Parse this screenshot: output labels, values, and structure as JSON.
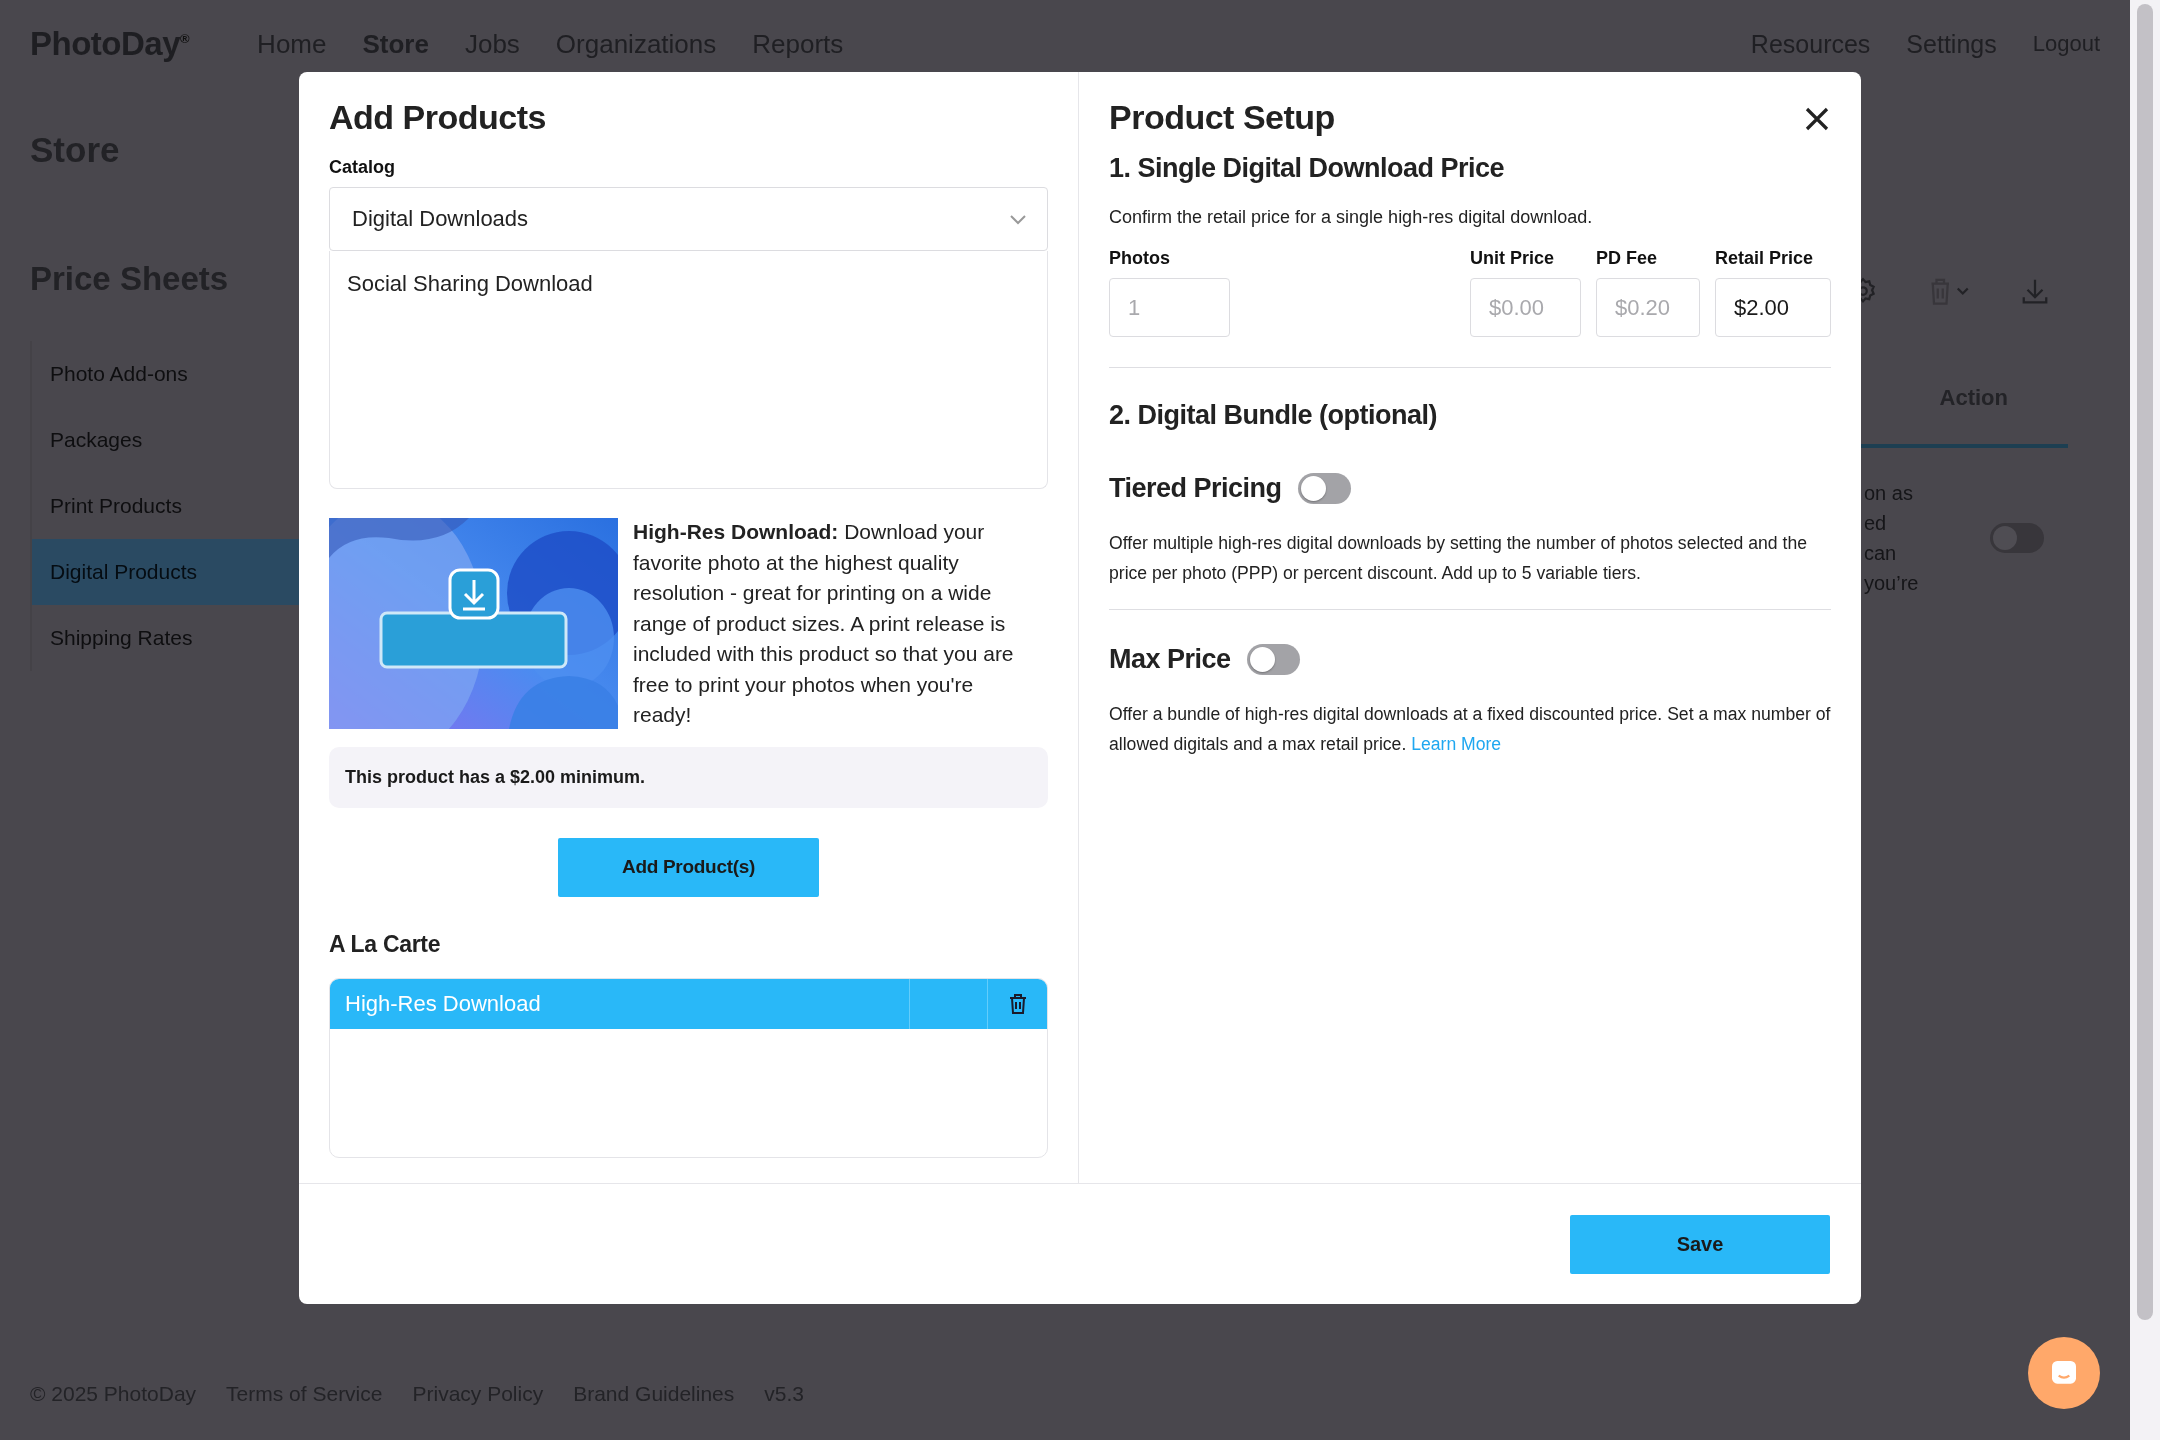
{
  "nav": {
    "logo": "PhotoDay",
    "logo_mark": "®",
    "links": [
      {
        "label": "Home",
        "selected": false
      },
      {
        "label": "Store",
        "selected": true
      },
      {
        "label": "Jobs",
        "selected": false
      },
      {
        "label": "Organizations",
        "selected": false
      },
      {
        "label": "Reports",
        "selected": false
      }
    ],
    "right_links": [
      "Resources",
      "Settings",
      "Logout"
    ]
  },
  "page": {
    "title": "Store",
    "section_title": "Price Sheets",
    "sidebar": [
      {
        "label": "Photo Add-ons",
        "selected": false
      },
      {
        "label": "Packages",
        "selected": false
      },
      {
        "label": "Print Products",
        "selected": false
      },
      {
        "label": "Digital Products",
        "selected": true
      },
      {
        "label": "Shipping Rates",
        "selected": false
      }
    ],
    "table": {
      "header": "Action",
      "cell_fragments": [
        "on as",
        "ed",
        "can",
        "you’re"
      ],
      "toggle": {
        "on": false
      }
    }
  },
  "modal": {
    "add_products": {
      "title": "Add Products",
      "catalog_label": "Catalog",
      "catalog_value": "Digital Downloads",
      "products": [
        "Social Sharing Download"
      ],
      "product": {
        "description": "**High-Res Download:** Download your favorite photo at the highest quality resolution - great for printing on a wide range of product sizes. A print release is included with this product so that you are free to print your photos when you're ready!",
        "notice": "This product has a $2.00 minimum."
      },
      "add_button": "Add Product(s)",
      "a_la_carte": {
        "title": "A La Carte",
        "rows": [
          {
            "name": "High-Res Download",
            "selected": true
          }
        ]
      }
    },
    "product_setup": {
      "title": "Product Setup",
      "section_1": {
        "title": "1. Single Digital Download Price",
        "description": "Confirm the retail price for a single high-res digital download.",
        "fields": [
          {
            "label": "Photos",
            "value": "1",
            "disabled": true
          },
          {
            "label": "Unit Price",
            "value": "$0.00",
            "disabled": true
          },
          {
            "label": "PD Fee",
            "value": "$0.20",
            "disabled": true
          },
          {
            "label": "Retail Price",
            "value": "$2.00",
            "disabled": false
          }
        ]
      },
      "section_2": {
        "title": "2. Digital Bundle (optional)",
        "options": [
          {
            "label": "Tiered Pricing",
            "on": false,
            "description": "Offer multiple high-res digital downloads by setting the number of photos selected and the price per photo (PPP) or percent discount. Add up to 5 variable tiers."
          },
          {
            "label": "Max Price",
            "on": false,
            "description": "Offer a bundle of high-res digital downloads at a fixed discounted price. Set a max number of allowed digitals and a max retail price.",
            "link": "Learn More"
          }
        ]
      }
    },
    "save_button": "Save"
  },
  "footer": {
    "links": [
      "© 2025 PhotoDay",
      "Terms of Service",
      "Privacy Policy",
      "Brand Guidelines",
      "v5.3"
    ]
  }
}
